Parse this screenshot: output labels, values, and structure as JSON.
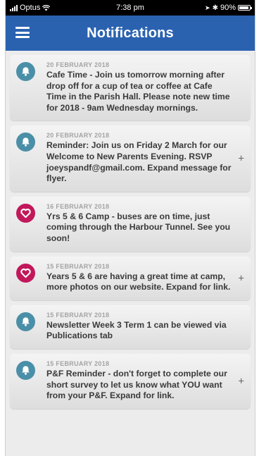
{
  "status_bar": {
    "carrier": "Optus",
    "time": "7:38 pm",
    "battery": "90%"
  },
  "header": {
    "title": "Notifications"
  },
  "colors": {
    "header": "#2a62b0",
    "bell_accent": "#4a8fa8",
    "heart_accent": "#c2185b"
  },
  "notifications": [
    {
      "icon": "bell-icon",
      "date": "20 FEBRUARY 2018",
      "message": "Cafe Time - Join us tomorrow morning after drop off for a cup of tea or coffee at Cafe Time in the Parish Hall. Please note new time for 2018 - 9am Wednesday mornings.",
      "expand": ""
    },
    {
      "icon": "bell-icon",
      "date": "20 FEBRUARY 2018",
      "message": "Reminder: Join us on Friday 2 March for our Welcome to New Parents Evening. RSVP joeyspandf@gmail.com. Expand message for flyer.",
      "expand": "+"
    },
    {
      "icon": "heart-icon",
      "date": "16 FEBRUARY 2018",
      "message": "Yrs 5 & 6 Camp - buses are on time, just coming through the Harbour Tunnel. See you soon!",
      "expand": ""
    },
    {
      "icon": "heart-icon",
      "date": "15 FEBRUARY 2018",
      "message": "Years 5 & 6 are having a great time at camp, more photos on our website. Expand for link.",
      "expand": "+"
    },
    {
      "icon": "bell-icon",
      "date": "15 FEBRUARY 2018",
      "message": "Newsletter Week 3 Term 1 can be viewed via Publications tab",
      "expand": ""
    },
    {
      "icon": "bell-icon",
      "date": "15 FEBRUARY 2018",
      "message": "P&F Reminder - don't forget to complete our short survey to let us know what YOU want from your P&F. Expand for link.",
      "expand": "+"
    }
  ]
}
